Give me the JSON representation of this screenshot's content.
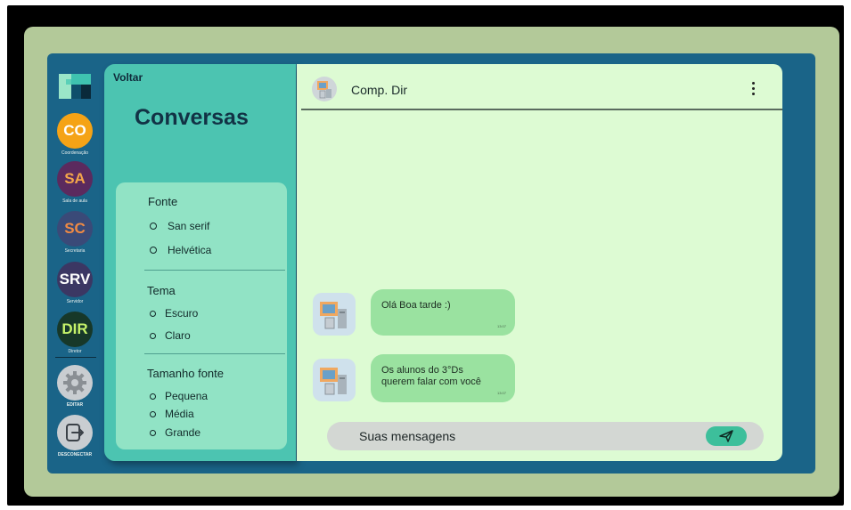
{
  "rail": {
    "items": [
      {
        "abbr": "CO",
        "caption": "Coordenação",
        "bg": "#f5a316",
        "fg": "#ffffff"
      },
      {
        "abbr": "SA",
        "caption": "Sala de aula",
        "bg": "#5b2a5e",
        "fg": "#f4a64a"
      },
      {
        "abbr": "SC",
        "caption": "Secretaria",
        "bg": "#3a4a78",
        "fg": "#f08a44"
      },
      {
        "abbr": "SRV",
        "caption": "Servidor",
        "bg": "#3b3763",
        "fg": "#ffffff"
      },
      {
        "abbr": "DIR",
        "caption": "Diretor",
        "bg": "#173829",
        "fg": "#c6f36a"
      }
    ],
    "edit_label": "EDITAR",
    "logout_label": "DESCONECTAR"
  },
  "sidebar": {
    "back_label": "Voltar",
    "title": "Conversas",
    "font_heading": "Fonte",
    "font_options": [
      "San serif",
      "Helvética"
    ],
    "theme_heading": "Tema",
    "theme_options": [
      "Escuro",
      "Claro"
    ],
    "size_heading": "Tamanho fonte",
    "size_options": [
      "Pequena",
      "Média",
      "Grande"
    ]
  },
  "chat": {
    "contact_name": "Comp. Dir",
    "messages": [
      {
        "text": "Olá Boa tarde :)",
        "time": "13:07"
      },
      {
        "text_line1": "Os alunos do 3°Ds",
        "text_line2": "querem falar com você",
        "time": "13:07"
      }
    ],
    "input_placeholder": "Suas mensagens"
  },
  "colors": {
    "panel": "#1a6488",
    "sidebar": "#4cc4b1",
    "settings_card": "#91e3c5",
    "chat_bg": "#ddfbd3",
    "bubble": "#9ae2a0",
    "send_button": "#3dbf9b"
  }
}
